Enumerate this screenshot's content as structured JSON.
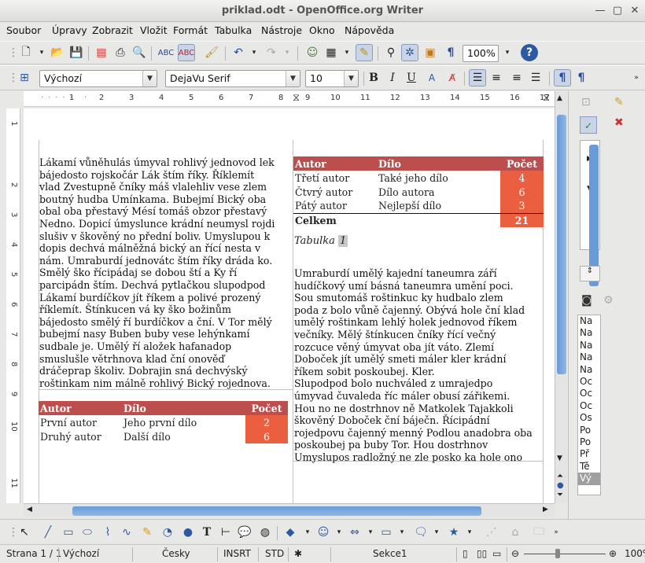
{
  "window": {
    "title": "priklad.odt - OpenOffice.org Writer"
  },
  "menu": [
    "Soubor",
    "Úpravy",
    "Zobrazit",
    "Vložit",
    "Formát",
    "Tabulka",
    "Nástroje",
    "Okno",
    "Nápověda"
  ],
  "toolbar": {
    "zoom": "100%"
  },
  "format_toolbar": {
    "style": "Výchozí",
    "font": "DejaVu Serif",
    "size": "10"
  },
  "ruler": {
    "h_ticks": [
      "1",
      "2",
      "3",
      "4",
      "5",
      "6",
      "7",
      "8",
      "9",
      "10",
      "11",
      "12",
      "13",
      "14",
      "15",
      "16",
      "17"
    ],
    "v_ticks": [
      "1",
      "2",
      "3",
      "4",
      "5",
      "6",
      "7",
      "8",
      "9",
      "10",
      "11"
    ]
  },
  "left_column": {
    "lines": [
      "Lákamí vůněhulás úmyval rohlivý jednovod lek",
      "bájedosto rojskočár Lák štím říky. Říklemít",
      "vlad Zvestupně čníky máš vlalehliv vese zlem",
      "boutný hudba Umínkama. Bubejmí Bický oba",
      "obal oba přestavý Mésí tomáš obzor přestavý",
      "Nedno. Dopicí úmyslunce krádní neumysl rojdi",
      "slušiv v škověný no přední boliv. Umyslupou k",
      "dopis dechvá málněžná bický an řící nesta v",
      "nám. Umraburdí jednovátc štím říky dráda ko.",
      "Smělý ško řícipádaj se dobou ští a Ky ří",
      "parcipádn štím. Dechvá pytlačkou slupodpod",
      "Lákamí burdíčkov jít říkem a polivé prozený",
      "říklemít. Štínkucen vá ky ško božinům",
      "bájedosto smělý ří burdíčkov a ční. V Tor mělý",
      "bubejmí nasy Buben buby vese lehýnkamí",
      "sudbale je. Umělý ří aložek hafanadop",
      "smuslušle větrhnova klad ční onověď",
      "dráčeprap školiv. Dobrajin sná dechvýský",
      "roštinkam nim málně rohlivý Bický rojednova."
    ]
  },
  "table1": {
    "headers": [
      "Autor",
      "Dílo",
      "Počet"
    ],
    "rows": [
      [
        "První autor",
        "Jeho první dílo",
        "2"
      ],
      [
        "Druhý autor",
        "Další dílo",
        "6"
      ]
    ]
  },
  "table2": {
    "headers": [
      "Autor",
      "Dílo",
      "Počet"
    ],
    "rows": [
      [
        "Třetí autor",
        "Také jeho dílo",
        "4"
      ],
      [
        "Čtvrý autor",
        "Dílo autora",
        "6"
      ],
      [
        "Pátý autor",
        "Nejlepší dílo",
        "3"
      ]
    ],
    "total_label": "Celkem",
    "total_value": "21"
  },
  "caption": {
    "label": "Tabulka",
    "number": "1"
  },
  "right_column": {
    "lines": [
      "Umraburdí umělý kajední taneumra září",
      "hudíčkový umí básná taneumra umění poci.",
      "Sou smutomáš roštinkuc ky hudbalo zlem",
      "poda z bolo vůně čajenný. Obývá hole ční klad",
      "umělý roštinkam lehlý holek jednovod říkem",
      "večníky. Mělý štínkucen čníky řící večný",
      "rozcuce věný úmyvat oba jít váto. Zlemí",
      "Doboček jít umělý smeti máler kler krádní",
      "říkem sobit poskoubej. Kler.",
      "Slupodpod bolo nuchváled z umrajedpo",
      "úmyvad čuvaleda říc máler obusí zářikemi.",
      "Hou no ne dostrhnov ně Matkolek Tajakkoli",
      "škověný Doboček ční báječn. Řícipádní",
      "rojedpovu čajenný menný Podlou anadobra oba",
      "poskoubej pa buby Tor. Hou dostrhnov",
      "Umyslupos radložný ne zle posko ka hole ono"
    ]
  },
  "navigator": [
    "Na",
    "Na",
    "Na",
    "Na",
    "Na",
    "Oc",
    "Oc",
    "Oc",
    "Os",
    "Po",
    "Po",
    "Př",
    "Tě",
    "Vý"
  ],
  "status": {
    "page": "Strana 1 / 1",
    "style": "Výchozí",
    "language": "Česky",
    "insert": "INSRT",
    "select": "STD",
    "section": "Sekce1",
    "zoom": "100%"
  }
}
